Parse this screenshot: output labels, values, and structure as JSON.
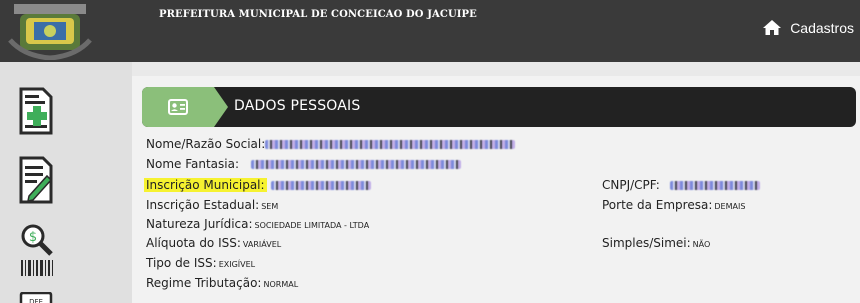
{
  "header": {
    "municipality": "PREFEITURA MUNICIPAL DE CONCEICAO DO JACUIPE",
    "nav_cadastros": "Cadastros",
    "crest_icon": "crest-icon",
    "home_icon": "home-icon"
  },
  "sidebar": {
    "items": [
      {
        "icon": "add-document-icon"
      },
      {
        "icon": "edit-document-icon"
      },
      {
        "icon": "search-money-barcode-icon"
      },
      {
        "icon": "dfe-document-icon"
      }
    ]
  },
  "section": {
    "title": "DADOS PESSOAIS",
    "badge_icon": "id-card-icon",
    "badge_color": "#8bbf7a"
  },
  "fields": {
    "razao_social_label": "Nome/Razão Social:",
    "nome_fantasia_label": "Nome Fantasia:",
    "inscricao_municipal_label": "Inscrição Municipal:",
    "inscricao_estadual_label": "Inscrição Estadual:",
    "inscricao_estadual_value": "SEM",
    "natureza_juridica_label": "Natureza Jurídica:",
    "natureza_juridica_value": "SOCIEDADE LIMITADA - LTDA",
    "aliquota_label": "Alíquota do ISS:",
    "aliquota_value": "VARIÁVEL",
    "tipo_iss_label": "Tipo de ISS:",
    "tipo_iss_value": "EXIGÍVEL",
    "regime_label": "Regime Tributação:",
    "regime_value": "NORMAL",
    "cnpj_label": "CNPJ/CPF:",
    "porte_label": "Porte da Empresa:",
    "porte_value": "DEMAIS",
    "simples_label": "Simples/Simei:",
    "simples_value": "NÃO"
  },
  "colors": {
    "header_bg": "#3a3a3a",
    "highlight": "#f6f230",
    "section_bg": "#222222"
  }
}
